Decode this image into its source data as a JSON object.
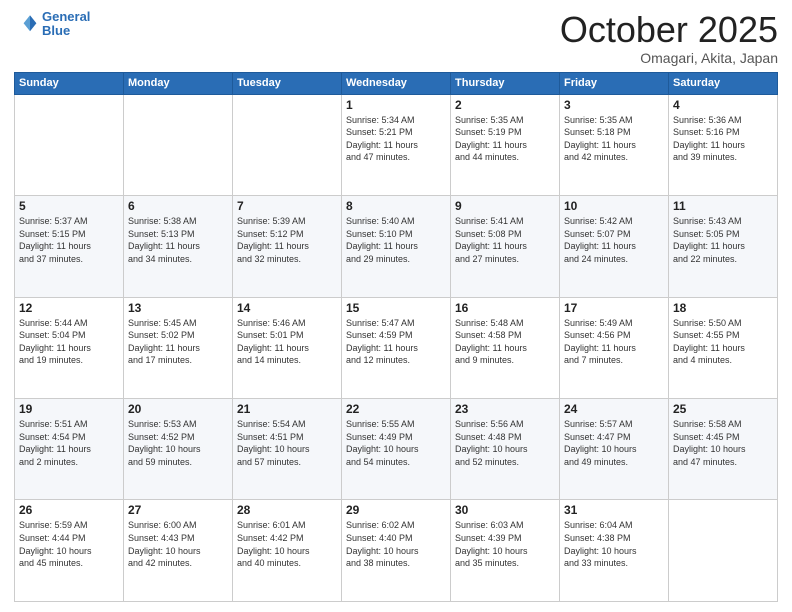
{
  "header": {
    "logo_line1": "General",
    "logo_line2": "Blue",
    "month": "October 2025",
    "location": "Omagari, Akita, Japan"
  },
  "days_of_week": [
    "Sunday",
    "Monday",
    "Tuesday",
    "Wednesday",
    "Thursday",
    "Friday",
    "Saturday"
  ],
  "weeks": [
    [
      {
        "day": "",
        "info": ""
      },
      {
        "day": "",
        "info": ""
      },
      {
        "day": "",
        "info": ""
      },
      {
        "day": "1",
        "info": "Sunrise: 5:34 AM\nSunset: 5:21 PM\nDaylight: 11 hours\nand 47 minutes."
      },
      {
        "day": "2",
        "info": "Sunrise: 5:35 AM\nSunset: 5:19 PM\nDaylight: 11 hours\nand 44 minutes."
      },
      {
        "day": "3",
        "info": "Sunrise: 5:35 AM\nSunset: 5:18 PM\nDaylight: 11 hours\nand 42 minutes."
      },
      {
        "day": "4",
        "info": "Sunrise: 5:36 AM\nSunset: 5:16 PM\nDaylight: 11 hours\nand 39 minutes."
      }
    ],
    [
      {
        "day": "5",
        "info": "Sunrise: 5:37 AM\nSunset: 5:15 PM\nDaylight: 11 hours\nand 37 minutes."
      },
      {
        "day": "6",
        "info": "Sunrise: 5:38 AM\nSunset: 5:13 PM\nDaylight: 11 hours\nand 34 minutes."
      },
      {
        "day": "7",
        "info": "Sunrise: 5:39 AM\nSunset: 5:12 PM\nDaylight: 11 hours\nand 32 minutes."
      },
      {
        "day": "8",
        "info": "Sunrise: 5:40 AM\nSunset: 5:10 PM\nDaylight: 11 hours\nand 29 minutes."
      },
      {
        "day": "9",
        "info": "Sunrise: 5:41 AM\nSunset: 5:08 PM\nDaylight: 11 hours\nand 27 minutes."
      },
      {
        "day": "10",
        "info": "Sunrise: 5:42 AM\nSunset: 5:07 PM\nDaylight: 11 hours\nand 24 minutes."
      },
      {
        "day": "11",
        "info": "Sunrise: 5:43 AM\nSunset: 5:05 PM\nDaylight: 11 hours\nand 22 minutes."
      }
    ],
    [
      {
        "day": "12",
        "info": "Sunrise: 5:44 AM\nSunset: 5:04 PM\nDaylight: 11 hours\nand 19 minutes."
      },
      {
        "day": "13",
        "info": "Sunrise: 5:45 AM\nSunset: 5:02 PM\nDaylight: 11 hours\nand 17 minutes."
      },
      {
        "day": "14",
        "info": "Sunrise: 5:46 AM\nSunset: 5:01 PM\nDaylight: 11 hours\nand 14 minutes."
      },
      {
        "day": "15",
        "info": "Sunrise: 5:47 AM\nSunset: 4:59 PM\nDaylight: 11 hours\nand 12 minutes."
      },
      {
        "day": "16",
        "info": "Sunrise: 5:48 AM\nSunset: 4:58 PM\nDaylight: 11 hours\nand 9 minutes."
      },
      {
        "day": "17",
        "info": "Sunrise: 5:49 AM\nSunset: 4:56 PM\nDaylight: 11 hours\nand 7 minutes."
      },
      {
        "day": "18",
        "info": "Sunrise: 5:50 AM\nSunset: 4:55 PM\nDaylight: 11 hours\nand 4 minutes."
      }
    ],
    [
      {
        "day": "19",
        "info": "Sunrise: 5:51 AM\nSunset: 4:54 PM\nDaylight: 11 hours\nand 2 minutes."
      },
      {
        "day": "20",
        "info": "Sunrise: 5:53 AM\nSunset: 4:52 PM\nDaylight: 10 hours\nand 59 minutes."
      },
      {
        "day": "21",
        "info": "Sunrise: 5:54 AM\nSunset: 4:51 PM\nDaylight: 10 hours\nand 57 minutes."
      },
      {
        "day": "22",
        "info": "Sunrise: 5:55 AM\nSunset: 4:49 PM\nDaylight: 10 hours\nand 54 minutes."
      },
      {
        "day": "23",
        "info": "Sunrise: 5:56 AM\nSunset: 4:48 PM\nDaylight: 10 hours\nand 52 minutes."
      },
      {
        "day": "24",
        "info": "Sunrise: 5:57 AM\nSunset: 4:47 PM\nDaylight: 10 hours\nand 49 minutes."
      },
      {
        "day": "25",
        "info": "Sunrise: 5:58 AM\nSunset: 4:45 PM\nDaylight: 10 hours\nand 47 minutes."
      }
    ],
    [
      {
        "day": "26",
        "info": "Sunrise: 5:59 AM\nSunset: 4:44 PM\nDaylight: 10 hours\nand 45 minutes."
      },
      {
        "day": "27",
        "info": "Sunrise: 6:00 AM\nSunset: 4:43 PM\nDaylight: 10 hours\nand 42 minutes."
      },
      {
        "day": "28",
        "info": "Sunrise: 6:01 AM\nSunset: 4:42 PM\nDaylight: 10 hours\nand 40 minutes."
      },
      {
        "day": "29",
        "info": "Sunrise: 6:02 AM\nSunset: 4:40 PM\nDaylight: 10 hours\nand 38 minutes."
      },
      {
        "day": "30",
        "info": "Sunrise: 6:03 AM\nSunset: 4:39 PM\nDaylight: 10 hours\nand 35 minutes."
      },
      {
        "day": "31",
        "info": "Sunrise: 6:04 AM\nSunset: 4:38 PM\nDaylight: 10 hours\nand 33 minutes."
      },
      {
        "day": "",
        "info": ""
      }
    ]
  ]
}
